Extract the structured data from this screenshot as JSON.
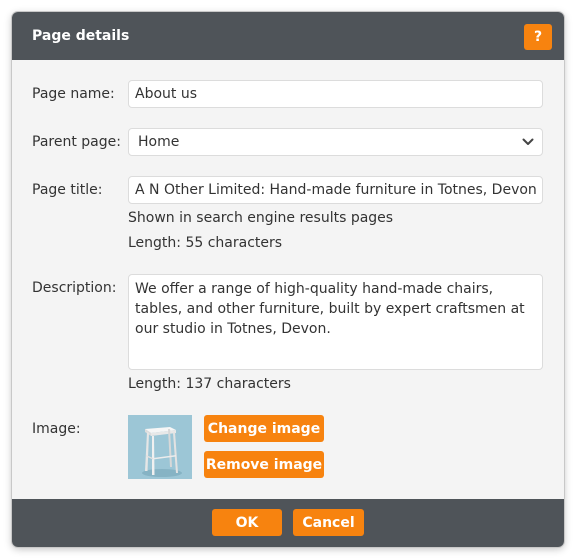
{
  "dialog": {
    "title": "Page details",
    "help_label": "?"
  },
  "form": {
    "page_name": {
      "label": "Page name:",
      "value": "About us"
    },
    "parent_page": {
      "label": "Parent page:",
      "value": "Home"
    },
    "page_title": {
      "label": "Page title:",
      "value": "A N Other Limited: Hand-made furniture in Totnes, Devon",
      "hint": "Shown in search engine results pages",
      "length": "Length: 55 characters"
    },
    "description": {
      "label": "Description:",
      "value": "We offer a range of high-quality hand-made chairs, tables, and other furniture, built by expert craftsmen at our studio in Totnes, Devon.",
      "length": "Length: 137 characters"
    },
    "image": {
      "label": "Image:",
      "change_label": "Change image",
      "remove_label": "Remove image"
    }
  },
  "footer": {
    "ok_label": "OK",
    "cancel_label": "Cancel"
  },
  "colors": {
    "accent": "#f7830f",
    "header_bg": "#4f5459",
    "body_bg": "#f4f4f4"
  },
  "icons": [
    "chevron-down-icon",
    "stool-image"
  ]
}
